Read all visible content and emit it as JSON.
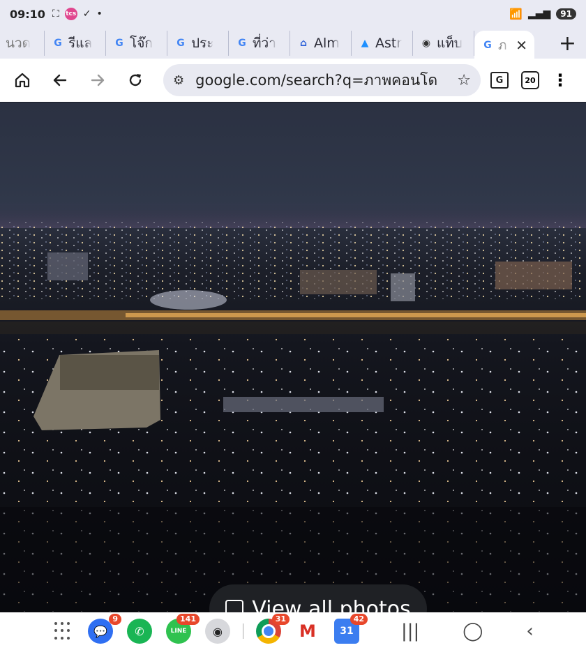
{
  "status_bar": {
    "time": "09:10",
    "icons": [
      "screenshot-icon",
      "tlink-app-icon",
      "check-circle-icon",
      "dot-icon"
    ],
    "tlink_text": "tcs",
    "battery": "91"
  },
  "tabs": [
    {
      "label": "นวด",
      "favicon": "none"
    },
    {
      "label": "รีแล",
      "favicon": "google"
    },
    {
      "label": "โจ๊ก",
      "favicon": "google"
    },
    {
      "label": "ประ",
      "favicon": "google"
    },
    {
      "label": "ที่ว่า",
      "favicon": "google"
    },
    {
      "label": "Alm",
      "favicon": "home-blue"
    },
    {
      "label": "Astr",
      "favicon": "astra"
    },
    {
      "label": "แท็บ",
      "favicon": "chrome"
    },
    {
      "label": "ภ",
      "favicon": "google",
      "active": true
    }
  ],
  "toolbar": {
    "url": "google.com/search?q=ภาพคอนโด",
    "tab_count": "20"
  },
  "content": {
    "view_all_label": "View all photos"
  },
  "nav_bar": {
    "apps": [
      {
        "name": "messages",
        "badge": "9",
        "color": "#2f6ff2"
      },
      {
        "name": "phone",
        "badge": "",
        "color": "#19b554"
      },
      {
        "name": "line",
        "badge": "141",
        "color": "#2fc24f",
        "text": "LINE"
      },
      {
        "name": "camera",
        "badge": "",
        "color": "#d7d8dc"
      },
      {
        "name": "chrome",
        "badge": "31",
        "color": "#ffffff"
      },
      {
        "name": "gmail",
        "badge": "",
        "color": "#ffffff",
        "text": "M"
      },
      {
        "name": "calendar",
        "badge": "42",
        "color": "#3b7df0",
        "text": "31"
      }
    ]
  }
}
